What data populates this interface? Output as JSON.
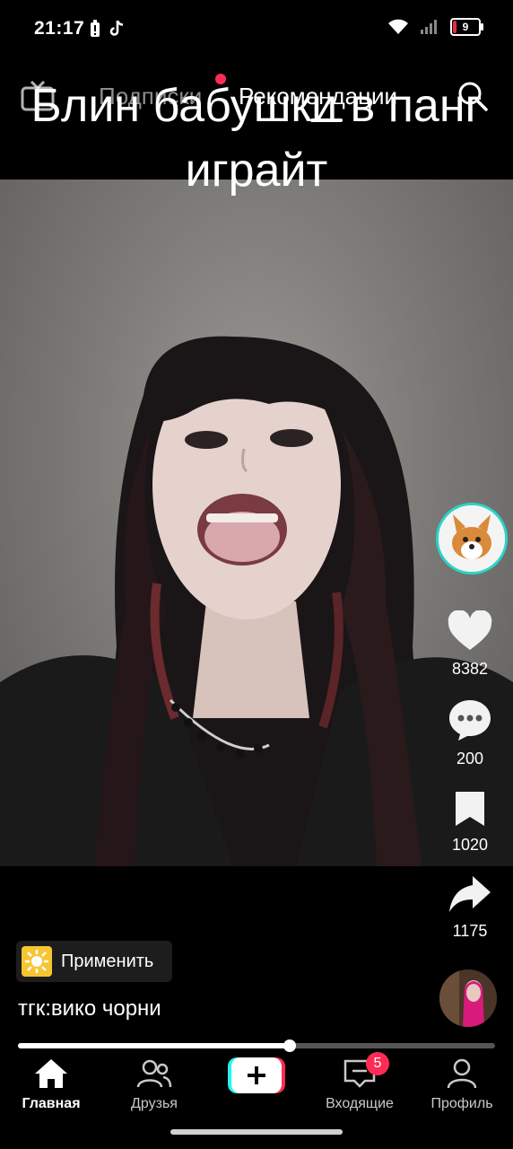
{
  "status_bar": {
    "time": "21:17",
    "battery_level": "9",
    "icons": [
      "battery-alert-icon",
      "tiktok-icon",
      "wifi-icon",
      "signal-icon",
      "battery-icon"
    ]
  },
  "top_nav": {
    "live_icon": "live-tv-icon",
    "tabs": [
      {
        "label": "Подписки",
        "active": false
      },
      {
        "label": "Рекомендации",
        "active": true
      }
    ],
    "search_icon": "search-icon"
  },
  "video": {
    "caption_line1": "Блин бабушки в панг",
    "caption_line2": "играйт"
  },
  "actions": {
    "likes": "8382",
    "comments": "200",
    "saves": "1020",
    "shares": "1175"
  },
  "effect_chip": {
    "label": "Применить"
  },
  "post": {
    "description": "тгк:вико чорни"
  },
  "progress": {
    "fraction": 0.57
  },
  "bottom_nav": {
    "items": [
      {
        "label": "Главная",
        "icon": "home-icon",
        "active": true
      },
      {
        "label": "Друзья",
        "icon": "friends-icon",
        "active": false
      },
      {
        "label": "",
        "icon": "plus-icon",
        "active": false
      },
      {
        "label": "Входящие",
        "icon": "inbox-icon",
        "active": false
      },
      {
        "label": "Профиль",
        "icon": "profile-icon",
        "active": false
      }
    ],
    "inbox_badge": "5"
  },
  "colors": {
    "accent": "#fe2c55",
    "teal": "#25f4ee",
    "avatar_ring": "#2bd4c8"
  }
}
